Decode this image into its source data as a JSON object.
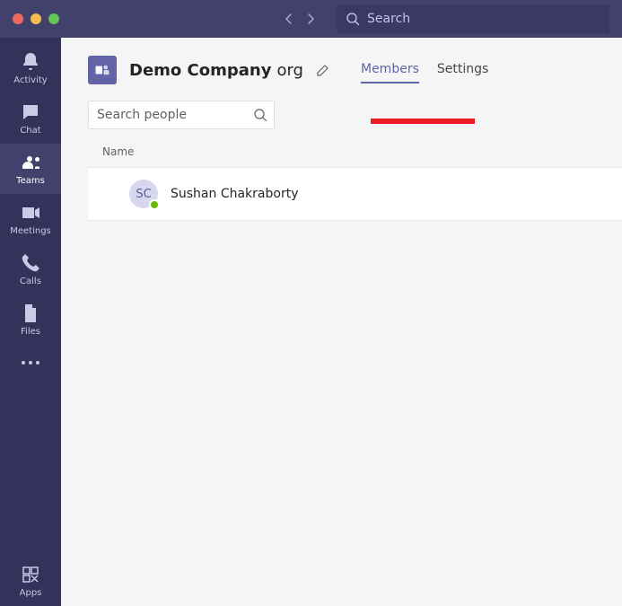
{
  "titlebar": {
    "search_placeholder": "Search"
  },
  "rail": {
    "items": [
      {
        "key": "activity",
        "label": "Activity"
      },
      {
        "key": "chat",
        "label": "Chat"
      },
      {
        "key": "teams",
        "label": "Teams"
      },
      {
        "key": "meetings",
        "label": "Meetings"
      },
      {
        "key": "calls",
        "label": "Calls"
      },
      {
        "key": "files",
        "label": "Files"
      }
    ],
    "apps_label": "Apps"
  },
  "header": {
    "team_bold": "Demo Company",
    "team_light": "org",
    "tabs": [
      {
        "key": "members",
        "label": "Members",
        "active": true
      },
      {
        "key": "settings",
        "label": "Settings",
        "active": false
      }
    ]
  },
  "people_search": {
    "placeholder": "Search people"
  },
  "columns": {
    "name": "Name"
  },
  "members": [
    {
      "initials": "SC",
      "name": "Sushan Chakraborty",
      "presence": "available"
    }
  ]
}
